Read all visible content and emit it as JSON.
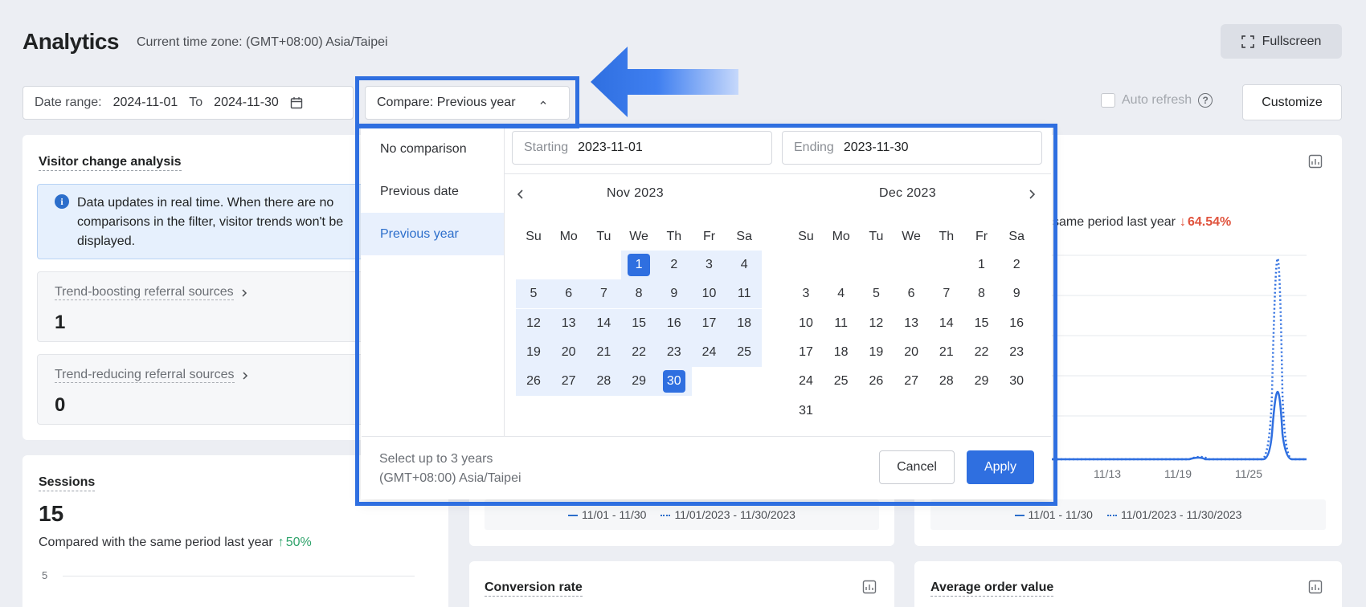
{
  "header": {
    "title": "Analytics",
    "timezone": "Current time zone: (GMT+08:00) Asia/Taipei",
    "fullscreen_label": "Fullscreen"
  },
  "filters": {
    "date_range_label": "Date range:",
    "start": "2024-11-01",
    "to_label": "To",
    "end": "2024-11-30",
    "compare_label": "Compare: Previous year",
    "auto_refresh_label": "Auto refresh",
    "customize_label": "Customize"
  },
  "visitor_card": {
    "title": "Visitor change analysis",
    "info_text": "Data updates in real time. When there are no comparisons in the filter, visitor trends won't be displayed.",
    "boosting_label": "Trend-boosting referral sources",
    "boosting_value": "1",
    "reducing_label": "Trend-reducing referral sources",
    "reducing_value": "0"
  },
  "sessions_card": {
    "title": "Sessions",
    "value": "15",
    "compare_text": "Compared with the same period last year",
    "change": "50%",
    "y_tick": "5"
  },
  "right_card": {
    "compare_text": "same period last year",
    "change": "64.54%",
    "x_ticks": [
      "11/13",
      "11/19",
      "11/25"
    ],
    "legend_current": "11/01 - 11/30",
    "legend_previous": "11/01/2023 - 11/30/2023"
  },
  "mid_card": {
    "legend_current": "11/01 - 11/30",
    "legend_previous": "11/01/2023 - 11/30/2023"
  },
  "bottom_cards": {
    "conversion_title": "Conversion rate",
    "aov_title": "Average order value"
  },
  "dropdown": {
    "options": [
      "No comparison",
      "Previous date",
      "Previous year"
    ],
    "starting_label": "Starting",
    "starting_value": "2023-11-01",
    "ending_label": "Ending",
    "ending_value": "2023-11-30",
    "left_month": "Nov  2023",
    "right_month": "Dec  2023",
    "weekdays": [
      "Su",
      "Mo",
      "Tu",
      "We",
      "Th",
      "Fr",
      "Sa"
    ],
    "footer_line1": "Select up to 3 years",
    "footer_line2": "(GMT+08:00) Asia/Taipei",
    "cancel_label": "Cancel",
    "apply_label": "Apply"
  },
  "colors": {
    "accent": "#2f6fe0",
    "positive": "#2fa36b",
    "negative": "#e0533d"
  }
}
